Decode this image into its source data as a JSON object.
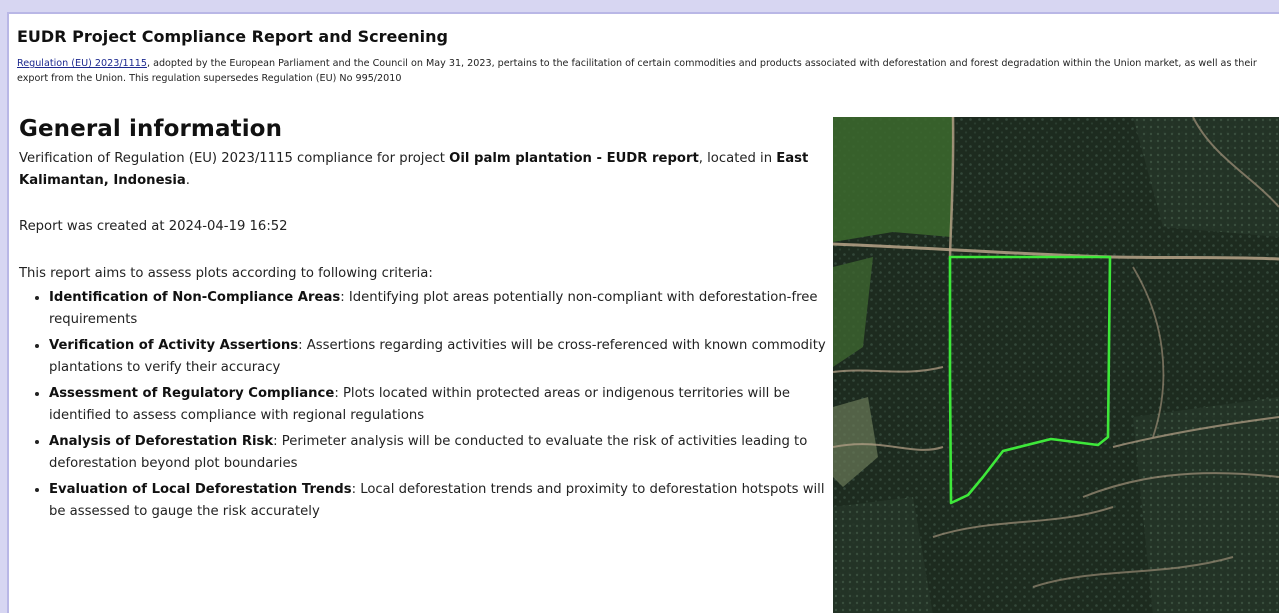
{
  "header": {
    "title": "EUDR Project Compliance Report and Screening",
    "regulation_link": "Regulation (EU) 2023/1115",
    "intro_text": ", adopted by the European Parliament and the Council on May 31, 2023, pertains to the facilitation of certain commodities and products associated with deforestation and forest degradation within the Union market, as well as their export from the Union. This regulation supersedes Regulation (EU) No 995/2010"
  },
  "general": {
    "heading": "General information",
    "verification_prefix": "Verification of Regulation (EU) 2023/1115 compliance for project ",
    "project_name": "Oil palm plantation - EUDR report",
    "located_text": ", located in ",
    "location": "East Kalimantan, Indonesia",
    "period": ".",
    "created_at": "Report was created at 2024-04-19 16:52",
    "aims": "This report aims to assess plots according to following criteria:",
    "criteria": [
      {
        "title": "Identification of Non-Compliance Areas",
        "text": ": Identifying plot areas potentially non-compliant with deforestation-free requirements"
      },
      {
        "title": "Verification of Activity Assertions",
        "text": ": Assertions regarding activities will be cross-referenced with known commodity plantations to verify their accuracy"
      },
      {
        "title": "Assessment of Regulatory Compliance",
        "text": ": Plots located within protected areas or indigenous territories will be identified to assess compliance with regional regulations"
      },
      {
        "title": "Analysis of Deforestation Risk",
        "text": ": Perimeter analysis will be conducted to evaluate the risk of activities leading to deforestation beyond plot boundaries"
      },
      {
        "title": "Evaluation of Local Deforestation Trends",
        "text": ": Local deforestation trends and proximity to deforestation hotspots will be assessed to gauge the risk accurately"
      }
    ]
  },
  "colors": {
    "page_bg": "#d7d6f2",
    "link": "#1d2a8f",
    "plot_outline": "#3ee83a",
    "forest_dark": "#1c2a1e",
    "road": "#b9a48a"
  }
}
